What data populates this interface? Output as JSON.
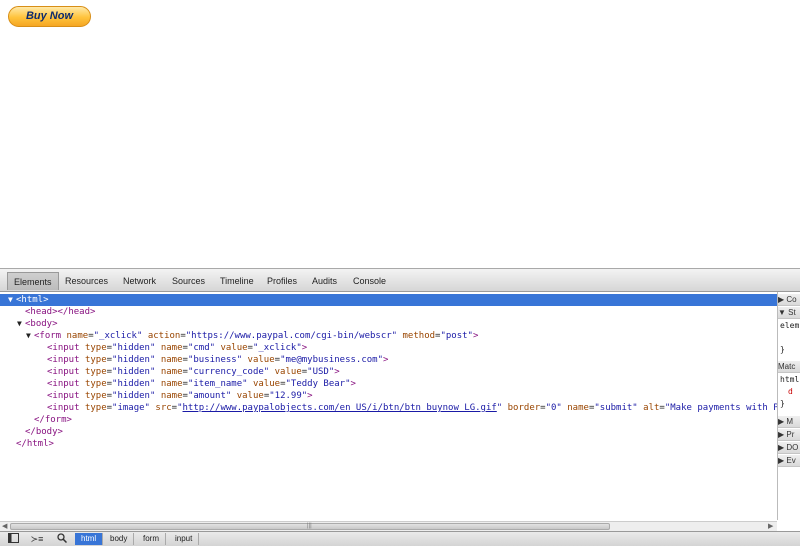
{
  "page": {
    "buy_now_label": "Buy Now"
  },
  "devtools": {
    "tabs": [
      "Elements",
      "Resources",
      "Network",
      "Sources",
      "Timeline",
      "Profiles",
      "Audits",
      "Console"
    ],
    "dom": {
      "l0": "<html>",
      "l1": "<head></head>",
      "l2": "<body>",
      "l3": {
        "open": "<form",
        "n1": "name",
        "v1": "\"_xclick\"",
        "n2": "action",
        "v2": "\"https://www.paypal.com/cgi-bin/webscr\"",
        "n3": "method",
        "v3": "\"post\"",
        "close": ">"
      },
      "l4": {
        "open": "<input",
        "n1": "type",
        "v1": "\"hidden\"",
        "n2": "name",
        "v2": "\"cmd\"",
        "n3": "value",
        "v3": "\"_xclick\"",
        "close": ">"
      },
      "l5": {
        "open": "<input",
        "n1": "type",
        "v1": "\"hidden\"",
        "n2": "name",
        "v2": "\"business\"",
        "n3": "value",
        "v3": "\"me@mybusiness.com\"",
        "close": ">"
      },
      "l6": {
        "open": "<input",
        "n1": "type",
        "v1": "\"hidden\"",
        "n2": "name",
        "v2": "\"currency_code\"",
        "n3": "value",
        "v3": "\"USD\"",
        "close": ">"
      },
      "l7": {
        "open": "<input",
        "n1": "type",
        "v1": "\"hidden\"",
        "n2": "name",
        "v2": "\"item_name\"",
        "n3": "value",
        "v3": "\"Teddy Bear\"",
        "close": ">"
      },
      "l8": {
        "open": "<input",
        "n1": "type",
        "v1": "\"hidden\"",
        "n2": "name",
        "v2": "\"amount\"",
        "n3": "value",
        "v3": "\"12.99\"",
        "close": ">"
      },
      "l9": {
        "open": "<input",
        "n1": "type",
        "v1": "\"image\"",
        "n2": "src",
        "q": "\"",
        "link": "http://www.paypalobjects.com/en_US/i/btn/btn_buynow_LG.gif",
        "n3": "border",
        "v3": "\"0\"",
        "n4": "name",
        "v4": "\"submit\"",
        "n5": "alt",
        "v5": "\"Make payments with P"
      },
      "l10": "</form>",
      "l11": "</body>",
      "l12": "</html>"
    },
    "sidebar": {
      "computed": "Co",
      "styles": "St",
      "element_style": "elem",
      "brace1": "}",
      "matched": "Matc",
      "html_rule": "html",
      "decl": "d",
      "brace2": "}",
      "metrics": "M",
      "properties": "Pr",
      "dom_breakpoints": "DO",
      "event_listeners": "Ev"
    },
    "breadcrumbs": [
      "html",
      "body",
      "form",
      "input"
    ],
    "icons": {
      "dock": "dock-icon",
      "console": "console-toggle-icon",
      "search": "search-icon"
    }
  }
}
